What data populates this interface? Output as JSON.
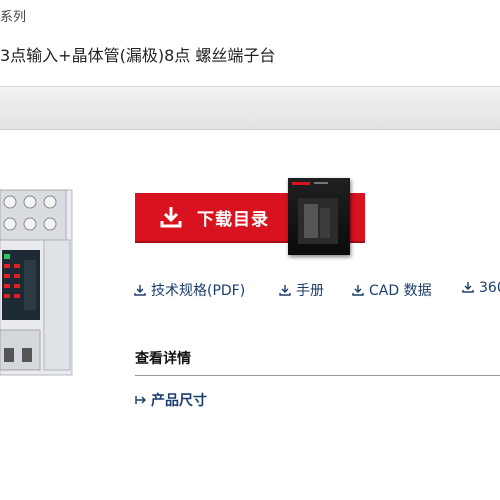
{
  "header": {
    "breadcrumb": "系列",
    "title": "3点输入+晶体管(漏极)8点 螺丝端子台"
  },
  "download": {
    "label": "下载目录"
  },
  "doc_links": [
    {
      "label": "技术规格(PDF)",
      "icon": "download-icon"
    },
    {
      "label": "手册",
      "icon": "download-icon"
    },
    {
      "label": "CAD 数据",
      "icon": "download-icon"
    },
    {
      "label": "360",
      "icon": "download-icon"
    }
  ],
  "details": {
    "heading": "查看详情",
    "links": [
      {
        "label": "产品尺寸",
        "icon": "arrow-link-icon"
      }
    ]
  },
  "colors": {
    "accent_red": "#d8121e",
    "link_blue": "#1b3d6d"
  }
}
